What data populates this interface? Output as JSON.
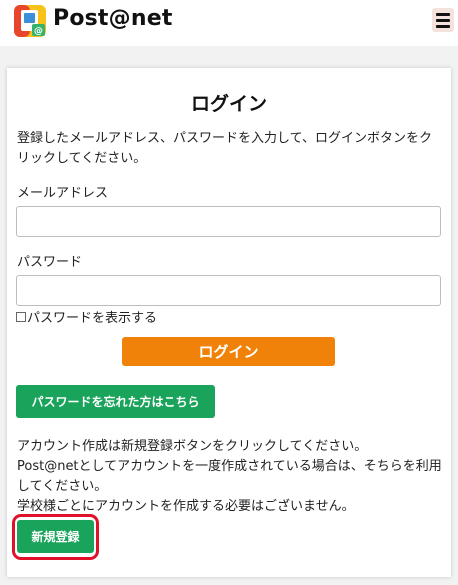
{
  "header": {
    "brand": "Post@net",
    "logo_icon": "post-at-net-logo-icon",
    "menu_icon": "hamburger-menu-icon"
  },
  "login": {
    "title": "ログイン",
    "intro": "登録したメールアドレス、パスワードを入力して、ログインボタンをクリックしてください。",
    "email_label": "メールアドレス",
    "email_value": "",
    "password_label": "パスワード",
    "password_value": "",
    "show_password_label": "パスワードを表示する",
    "login_button": "ログイン",
    "forgot_button": "パスワードを忘れた方はこちら"
  },
  "account": {
    "lines": [
      "アカウント作成は新規登録ボタンをクリックしてください。",
      "Post@netとしてアカウントを一度作成されている場合は、そちらを利用してください。",
      "学校様ごとにアカウントを作成する必要はございません。"
    ],
    "register_button": "新規登録"
  },
  "colors": {
    "login_button": "#f0820a",
    "green_button": "#1aa35b",
    "highlight": "#e0102a"
  }
}
